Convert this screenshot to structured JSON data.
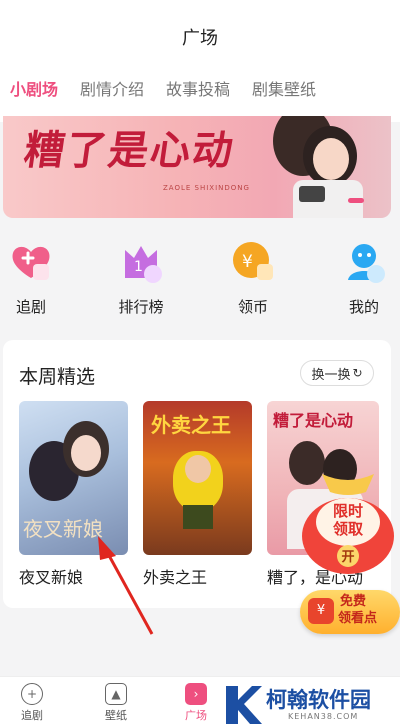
{
  "header": {
    "title": "广场"
  },
  "tabs": [
    {
      "label": "小剧场",
      "active": true
    },
    {
      "label": "剧情介绍",
      "active": false
    },
    {
      "label": "故事投稿",
      "active": false
    },
    {
      "label": "剧集壁纸",
      "active": false
    }
  ],
  "banner": {
    "title": "糟了是心动",
    "subtitle": "ZAOLE SHIXINDONG"
  },
  "quick_actions": [
    {
      "label": "追剧",
      "icon": "heart-plus-icon"
    },
    {
      "label": "排行榜",
      "icon": "crown-icon"
    },
    {
      "label": "领币",
      "icon": "coin-icon"
    },
    {
      "label": "我的",
      "icon": "user-icon"
    }
  ],
  "weekly": {
    "title": "本周精选",
    "refresh_label": "换一换",
    "items": [
      {
        "name": "夜叉新娘",
        "poster_text": "夜叉新娘"
      },
      {
        "name": "外卖之王",
        "poster_text": "外卖之王"
      },
      {
        "name": "糟了，是心动",
        "poster_text": "糟了是心动"
      }
    ]
  },
  "promo": {
    "bag_text": "限时领取",
    "bag_button": "开",
    "free_line1": "免费",
    "free_line2": "领看点"
  },
  "bottom_nav": [
    {
      "label": "追剧",
      "icon": "heart-plus-icon"
    },
    {
      "label": "壁纸",
      "icon": "image-icon"
    },
    {
      "label": "广场",
      "icon": "square-icon"
    }
  ],
  "watermark": {
    "brand": "柯翰软件园",
    "url": "KEHAN38.COM"
  },
  "colors": {
    "accent": "#ee4f7f",
    "background": "#f4f4f5"
  }
}
